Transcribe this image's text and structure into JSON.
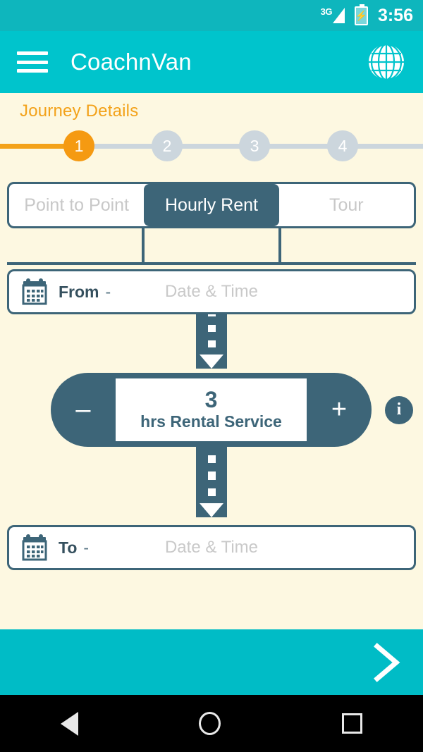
{
  "statusbar": {
    "network": "3G",
    "time": "3:56",
    "signal_icon": "signal-bars-icon",
    "battery_icon": "battery-charging-icon"
  },
  "appbar": {
    "title": "CoachnVan",
    "menu_icon": "hamburger-menu-icon",
    "globe_icon": "globe-icon"
  },
  "section": {
    "title": "Journey Details"
  },
  "stepper": {
    "steps": [
      {
        "label": "1",
        "state": "active"
      },
      {
        "label": "2",
        "state": "inactive"
      },
      {
        "label": "3",
        "state": "inactive"
      },
      {
        "label": "4",
        "state": "inactive"
      }
    ]
  },
  "tabs": [
    {
      "label": "Point to Point",
      "selected": false
    },
    {
      "label": "Hourly Rent",
      "selected": true
    },
    {
      "label": "Tour",
      "selected": false
    }
  ],
  "from_field": {
    "label": "From",
    "separator": "-",
    "placeholder": "Date & Time",
    "value": "",
    "icon": "calendar-icon"
  },
  "to_field": {
    "label": "To",
    "separator": "-",
    "placeholder": "Date & Time",
    "value": "",
    "icon": "calendar-icon"
  },
  "hours_control": {
    "decrement_label": "–",
    "increment_label": "+",
    "value": "3",
    "unit_label": "hrs Rental Service",
    "info_label": "i"
  },
  "footer": {
    "next_icon": "chevron-right-icon"
  },
  "navbar": {
    "back_icon": "triangle-back-icon",
    "home_icon": "circle-home-icon",
    "recents_icon": "square-recents-icon"
  },
  "colors": {
    "teal": "#00c4cc",
    "teal_dark": "#0eb6bd",
    "cream": "#fdf8e1",
    "slate": "#3d6578",
    "orange": "#f59a12",
    "gray": "#ccd6dd"
  }
}
